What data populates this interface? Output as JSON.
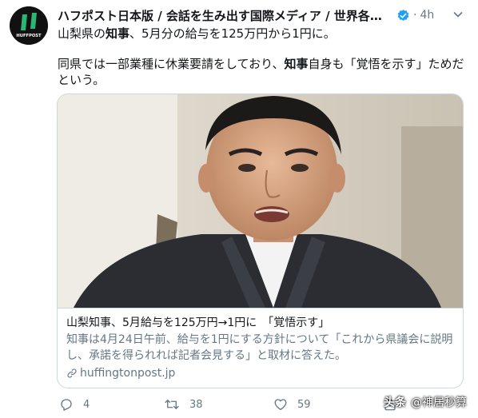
{
  "tweet": {
    "display_name": "ハフポスト日本版 / 会話を生み出す国際メディア / 世界各国...",
    "time": "4h",
    "avatar_text": "HUFFPOST",
    "line1_a": "山梨県の",
    "line1_b": "知事",
    "line1_c": "、5月分の給与を125万円から1円に。",
    "line2_a": "同県では一部業種に休業要請をしており、",
    "line2_b": "知事",
    "line2_c": "自身も「覚悟を示す」ためだという。"
  },
  "card": {
    "title": "山梨知事、5月給与を125万円→1円に　「覚悟示す」",
    "description": "知事は4月24日午前、給与を1円にする方針について「これから県議会に説明し、承諾を得られれば記者会見する」と取材に答えた。",
    "domain": "huffingtonpost.jp"
  },
  "actions": {
    "reply_count": "4",
    "retweet_count": "38",
    "like_count": "59"
  },
  "watermark": {
    "logo": "头条",
    "handle": "@神居秒算"
  },
  "colors": {
    "text": "#14171a",
    "secondary": "#657786",
    "border": "#ccd6dd",
    "verified": "#1da1f2",
    "huffpost_green": "#2bb673"
  },
  "icons": [
    "huffpost-logo-icon",
    "verified-badge-icon",
    "chevron-down-icon",
    "link-icon",
    "reply-icon",
    "retweet-icon",
    "like-icon",
    "share-icon"
  ]
}
